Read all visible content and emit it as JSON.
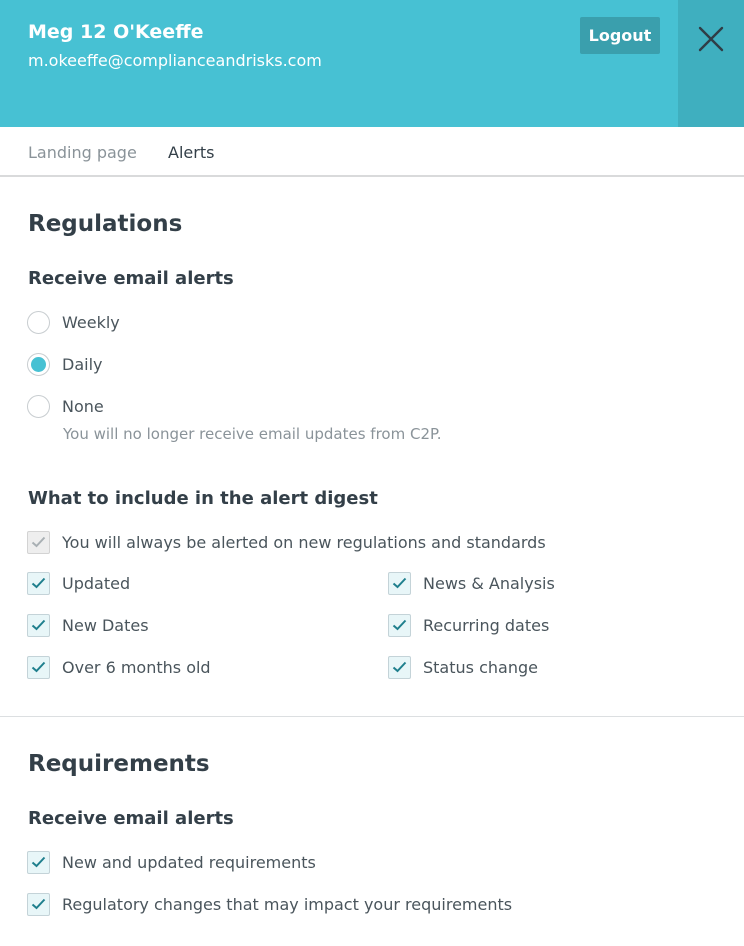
{
  "header": {
    "user_name": "Meg 12 O'Keeffe",
    "user_email": "m.okeeffe@complianceandrisks.com",
    "logout_label": "Logout",
    "close_icon": "close-icon"
  },
  "tabs": [
    {
      "label": "Landing page",
      "active": false
    },
    {
      "label": "Alerts",
      "active": true
    }
  ],
  "regulations": {
    "title": "Regulations",
    "email_alerts": {
      "heading": "Receive email alerts",
      "options": [
        {
          "label": "Weekly",
          "selected": false
        },
        {
          "label": "Daily",
          "selected": true
        },
        {
          "label": "None",
          "selected": false
        }
      ],
      "none_note": "You will no longer receive email updates from C2P."
    },
    "digest": {
      "heading": "What to include in the alert digest",
      "always_label": "You will always be alerted on new regulations and standards",
      "items": [
        {
          "label": "Updated",
          "checked": true
        },
        {
          "label": "News & Analysis",
          "checked": true
        },
        {
          "label": "New Dates",
          "checked": true
        },
        {
          "label": "Recurring dates",
          "checked": true
        },
        {
          "label": "Over 6 months old",
          "checked": true
        },
        {
          "label": "Status change",
          "checked": true
        }
      ]
    }
  },
  "requirements": {
    "title": "Requirements",
    "email_alerts": {
      "heading": "Receive email alerts",
      "items": [
        {
          "label": "New and updated requirements",
          "checked": true
        },
        {
          "label": "Regulatory changes that may impact your requirements",
          "checked": true
        }
      ]
    }
  },
  "colors": {
    "header_bg": "#47c1d3",
    "header_side_bg": "#3fafbf",
    "logout_bg": "#3a9fad",
    "check_mark": "#1f7f8d",
    "text_dark": "#333f48",
    "text_muted": "#8a9399"
  }
}
